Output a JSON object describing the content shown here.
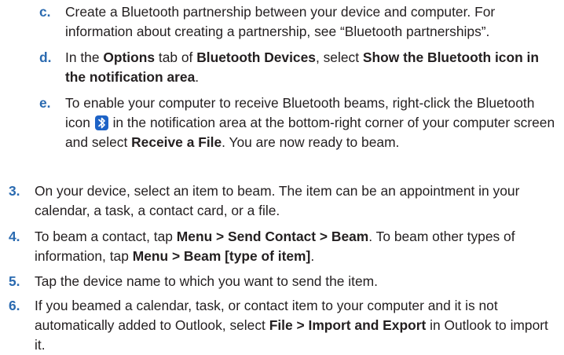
{
  "steps": {
    "c": {
      "marker": "c.",
      "t1": "Create a Bluetooth partnership between your device and computer. For information about creating a partnership, see “Bluetooth partnerships”."
    },
    "d": {
      "marker": "d.",
      "t1": "In the ",
      "b1": "Options",
      "t2": " tab of ",
      "b2": "Bluetooth Devices",
      "t3": ", select ",
      "b3": "Show the Bluetooth icon in the notification area",
      "t4": "."
    },
    "e": {
      "marker": "e.",
      "t1": "To enable your computer to receive Bluetooth beams, right-click the Bluetooth icon ",
      "icon": "bluetooth-icon",
      "t2": " in the notification area at the bottom-right corner of your computer screen and select ",
      "b1": "Receive a File",
      "t3": ". You are now ready to beam."
    },
    "s3": {
      "marker": "3.",
      "t1": "On your device, select an item to beam. The item can be an appointment in your calendar, a task, a contact card, or a file."
    },
    "s4": {
      "marker": "4.",
      "t1": "To beam a contact, tap ",
      "b1": "Menu > Send Contact > Beam",
      "t2": ". To beam other types of information, tap ",
      "b2": "Menu > Beam [type of item]",
      "t3": "."
    },
    "s5": {
      "marker": "5.",
      "t1": "Tap the device name to which you want to send the item."
    },
    "s6": {
      "marker": "6.",
      "t1": "If you beamed a calendar, task, or contact item to your computer and it is not automatically added to Outlook, select ",
      "b1": "File > Import and Export",
      "t2": " in Outlook to import it."
    }
  },
  "colors": {
    "marker": "#2a6ab0",
    "text": "#231f20",
    "bluetooth_icon_bg": "#1e63c6"
  }
}
